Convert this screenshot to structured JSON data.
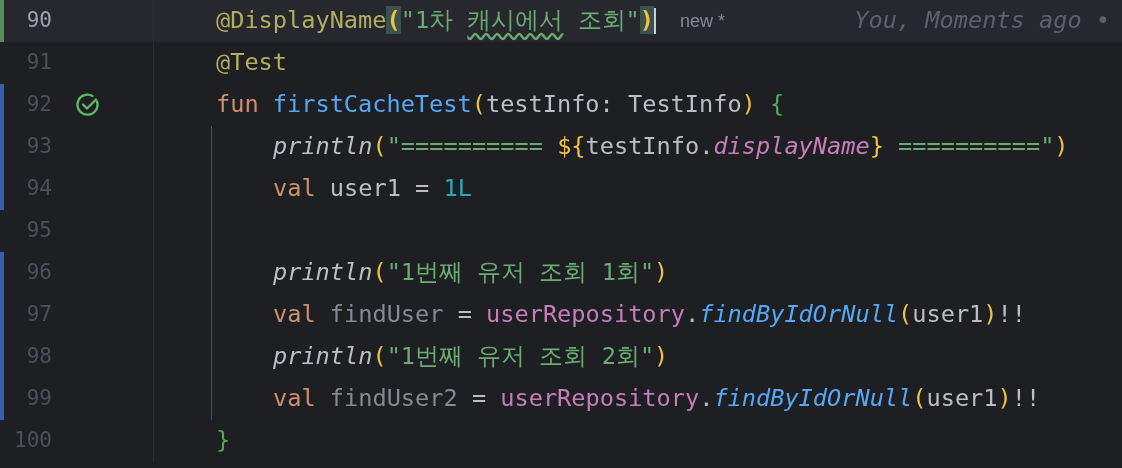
{
  "lines": [
    {
      "number": "90",
      "current": true,
      "color": "#549159",
      "caret_at_end": true,
      "hint": "new *",
      "blame": "You, Moments ago •",
      "tokens": [
        {
          "text": "@DisplayName",
          "kind": "annotation"
        },
        {
          "text": "(",
          "kind": "paren",
          "matched": true
        },
        {
          "text": "\"1차 ",
          "kind": "string"
        },
        {
          "text": "캐시에서",
          "kind": "string",
          "typo": true
        },
        {
          "text": " 조회\"",
          "kind": "string"
        },
        {
          "text": ")",
          "kind": "paren",
          "matched": true
        }
      ]
    },
    {
      "number": "91",
      "current": false,
      "tokens": [
        {
          "text": "@Test",
          "kind": "annotation"
        }
      ]
    },
    {
      "number": "92",
      "current": false,
      "color": "#375fad",
      "test_passed": true,
      "tokens": [
        {
          "text": "fun ",
          "kind": "keyword"
        },
        {
          "text": "firstCacheTest",
          "kind": "declaration"
        },
        {
          "text": "(",
          "kind": "bracket",
          "color": "#f0c143"
        },
        {
          "text": "testInfo: TestInfo",
          "kind": "text"
        },
        {
          "text": ")",
          "kind": "bracket",
          "color": "#f0c143"
        },
        {
          "text": " {",
          "kind": "bracket",
          "color": "#54a857"
        }
      ],
      "children": [
        {
          "number": "93",
          "current": false,
          "color": "#375fad",
          "tokens": [
            {
              "text": "println",
              "kind": "call"
            },
            {
              "text": "(",
              "kind": "bracket",
              "color": "#f0c143"
            },
            {
              "text": "\"========== ",
              "kind": "string"
            },
            {
              "text": "${",
              "kind": "bracket",
              "color": "#f0c143"
            },
            {
              "text": "testInfo.",
              "kind": "text"
            },
            {
              "text": "displayName",
              "kind": "property"
            },
            {
              "text": "}",
              "kind": "bracket",
              "color": "#f0c143"
            },
            {
              "text": " ==========\"",
              "kind": "string"
            },
            {
              "text": ")",
              "kind": "bracket",
              "color": "#f0c143"
            }
          ]
        },
        {
          "number": "94",
          "current": false,
          "color": "#375fad",
          "tokens": [
            {
              "text": "val ",
              "kind": "keyword"
            },
            {
              "text": "user1 = ",
              "kind": "text"
            },
            {
              "text": "1L",
              "kind": "number"
            }
          ]
        },
        {
          "number": "95",
          "current": false
        },
        {
          "number": "96",
          "current": false,
          "color": "#375fad",
          "tokens": [
            {
              "text": "println",
              "kind": "call"
            },
            {
              "text": "(",
              "kind": "bracket",
              "color": "#f0c143"
            },
            {
              "text": "\"1번째 유저 조회 1회\"",
              "kind": "string"
            },
            {
              "text": ")",
              "kind": "bracket",
              "color": "#f0c143"
            }
          ]
        },
        {
          "number": "97",
          "current": false,
          "color": "#375fad",
          "tokens": [
            {
              "text": "val ",
              "kind": "keyword"
            },
            {
              "text": "findUser",
              "kind": "unused"
            },
            {
              "text": " = ",
              "kind": "text"
            },
            {
              "text": "userRepository",
              "kind": "field"
            },
            {
              "text": ".",
              "kind": "text"
            },
            {
              "text": "findByIdOrNull",
              "kind": "method"
            },
            {
              "text": "(",
              "kind": "bracket",
              "color": "#f0c143"
            },
            {
              "text": "user1",
              "kind": "text"
            },
            {
              "text": ")",
              "kind": "bracket",
              "color": "#f0c143"
            },
            {
              "text": "!!",
              "kind": "text"
            }
          ]
        },
        {
          "number": "98",
          "current": false,
          "color": "#375fad",
          "tokens": [
            {
              "text": "println",
              "kind": "call"
            },
            {
              "text": "(",
              "kind": "bracket",
              "color": "#f0c143"
            },
            {
              "text": "\"1번째 유저 조회 2회\"",
              "kind": "string"
            },
            {
              "text": ")",
              "kind": "bracket",
              "color": "#f0c143"
            }
          ]
        },
        {
          "number": "99",
          "current": false,
          "color": "#375fad",
          "tokens": [
            {
              "text": "val ",
              "kind": "keyword"
            },
            {
              "text": "findUser2",
              "kind": "unused"
            },
            {
              "text": " = ",
              "kind": "text"
            },
            {
              "text": "userRepository",
              "kind": "field"
            },
            {
              "text": ".",
              "kind": "text"
            },
            {
              "text": "findByIdOrNull",
              "kind": "method"
            },
            {
              "text": "(",
              "kind": "bracket",
              "color": "#f0c143"
            },
            {
              "text": "user1",
              "kind": "text"
            },
            {
              "text": ")",
              "kind": "bracket",
              "color": "#f0c143"
            },
            {
              "text": "!!",
              "kind": "text"
            }
          ]
        }
      ]
    },
    {
      "number": "100",
      "current": false,
      "tokens": [
        {
          "text": "}",
          "kind": "bracket",
          "color": "#54a857"
        }
      ]
    }
  ]
}
